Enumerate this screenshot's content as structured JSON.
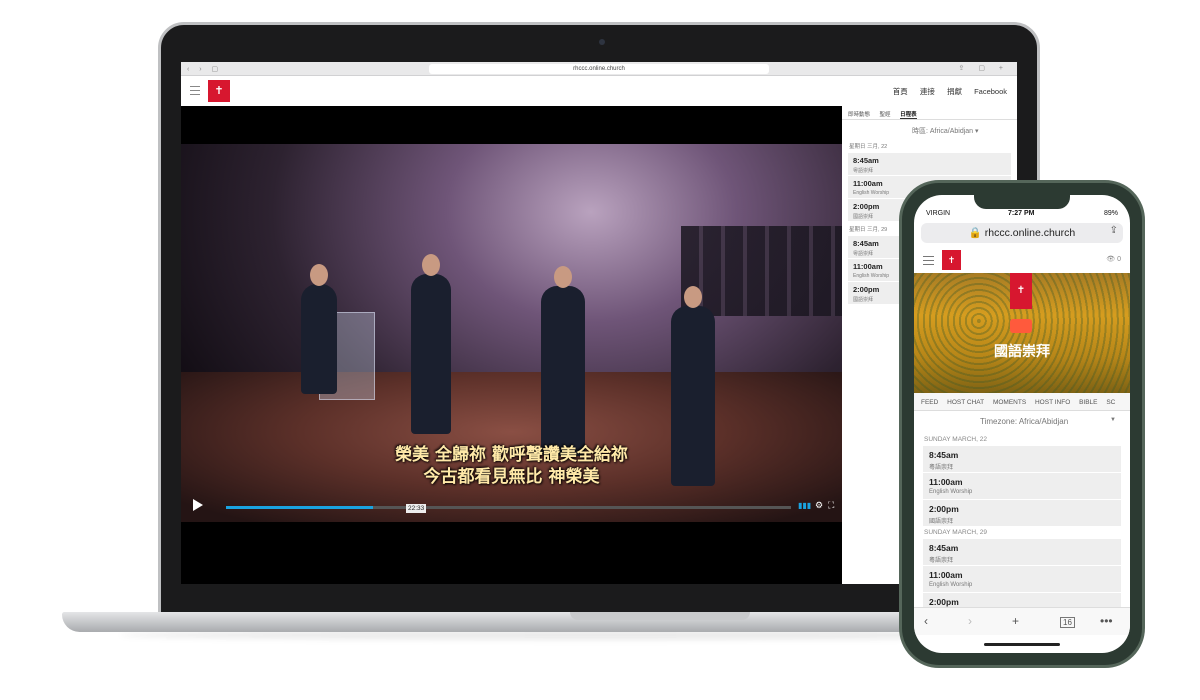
{
  "laptop": {
    "browser": {
      "url": "rhccc.online.church"
    },
    "nav": [
      "首頁",
      "連接",
      "捐獻",
      "Facebook"
    ],
    "video": {
      "subtitle_line1": "榮美 全歸祢 歡呼聲讚美全給祢",
      "subtitle_line2": "今古都看見無比 神榮美",
      "timestamp": "22:33",
      "progress": 0.26,
      "accent": "#1aa3e0"
    },
    "panel": {
      "tabs": [
        "即時動態",
        "聖經",
        "日程表"
      ],
      "timezone": "時區: Africa/Abidjan",
      "days": [
        {
          "label": "星期日 三月, 22",
          "events": [
            {
              "time": "8:45am",
              "desc": "粵語崇拜"
            },
            {
              "time": "11:00am",
              "desc": "English Worship"
            },
            {
              "time": "2:00pm",
              "desc": "國語崇拜"
            }
          ]
        },
        {
          "label": "星期日 三月, 29",
          "events": [
            {
              "time": "8:45am",
              "desc": "粵語崇拜"
            },
            {
              "time": "11:00am",
              "desc": "English Worship"
            },
            {
              "time": "2:00pm",
              "desc": "國語崇拜"
            }
          ]
        }
      ]
    }
  },
  "phone": {
    "status": {
      "carrier": "VIRGIN",
      "time": "7:27 PM",
      "battery": "89%"
    },
    "url": "rhccc.online.church",
    "viewer_count": "0",
    "hero_title": "國語崇拜",
    "tabs": [
      "FEED",
      "HOST CHAT",
      "MOMENTS",
      "HOST INFO",
      "BIBLE",
      "SC"
    ],
    "timezone_label": "Timezone:",
    "timezone_value": "Africa/Abidjan",
    "days": [
      {
        "label": "SUNDAY MARCH, 22",
        "events": [
          {
            "time": "8:45am",
            "desc": "粵語崇拜"
          },
          {
            "time": "11:00am",
            "desc": "English Worship"
          },
          {
            "time": "2:00pm",
            "desc": "國語崇拜"
          }
        ]
      },
      {
        "label": "SUNDAY MARCH, 29",
        "events": [
          {
            "time": "8:45am",
            "desc": "粵語崇拜"
          },
          {
            "time": "11:00am",
            "desc": "English Worship"
          },
          {
            "time": "2:00pm",
            "desc": ""
          }
        ]
      }
    ],
    "tab_count": "16",
    "brand_color": "#d7172f"
  }
}
